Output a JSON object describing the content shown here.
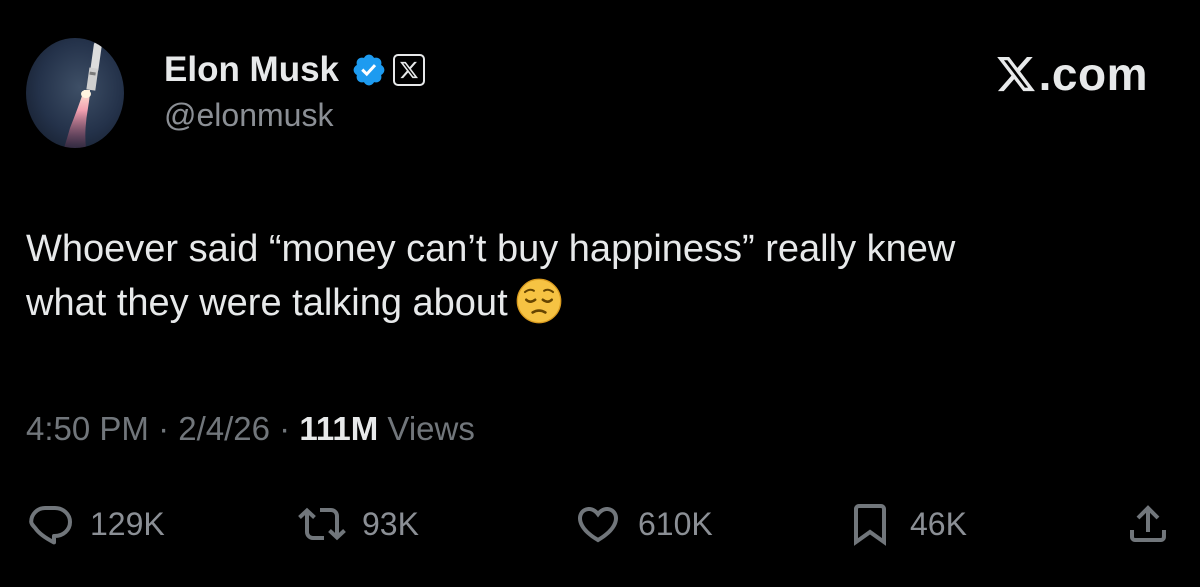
{
  "author": {
    "name": "Elon Musk",
    "handle": "@elonmusk",
    "verified_color": "#1d9bf0"
  },
  "brand": {
    "text": ".com",
    "icon": "x-logo-icon"
  },
  "tweet": {
    "text_line1": "Whoever said “money can’t buy happiness” really knew",
    "text_line2": "what they were talking about",
    "emoji": "pensive-face-icon"
  },
  "meta": {
    "time": "4:50 PM",
    "sep1": " · ",
    "date": "2/4/26",
    "sep2": " · ",
    "views_count": "111M",
    "views_label": " Views"
  },
  "actions": {
    "replies": "129K",
    "reposts": "93K",
    "likes": "610K",
    "bookmarks": "46K"
  },
  "colors": {
    "background": "#000000",
    "text": "#e7e9ea",
    "secondary": "#71767b",
    "verified": "#1d9bf0"
  }
}
